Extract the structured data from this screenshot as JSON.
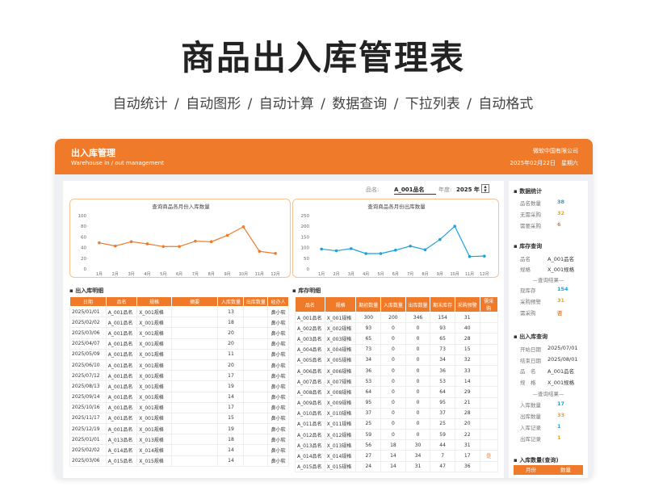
{
  "hero": {
    "title": "商品出入库管理表",
    "subtitle": "自动统计 / 自动图形 / 自动计算 / 数据查询 / 下拉列表 / 自动格式"
  },
  "header": {
    "title": "出入库管理",
    "subtitle": "Warehouse in / out management",
    "company": "微软中国有限公司",
    "date": "2025年02月22日",
    "weekday": "星期六"
  },
  "filter": {
    "name_label": "品名:",
    "name_value": "A_001品名",
    "year_label": "年度:",
    "year_value": "2025 年"
  },
  "charts": [
    {
      "title": "查询商品各月份入库数量",
      "yticks": [
        0,
        20,
        40,
        60,
        80,
        100
      ],
      "ylim": [
        0,
        100
      ]
    },
    {
      "title": "查询商品各月份出库数量",
      "yticks": [
        0,
        50,
        100,
        150,
        200,
        250
      ],
      "ylim": [
        0,
        250
      ]
    }
  ],
  "chart_data": [
    {
      "type": "line",
      "title": "查询商品各月份入库数量",
      "categories": [
        "1月",
        "2月",
        "3月",
        "4月",
        "5月",
        "6月",
        "7月",
        "8月",
        "9月",
        "10月",
        "11月",
        "12月"
      ],
      "values": [
        49,
        43,
        51,
        47,
        42,
        42,
        52,
        51,
        63,
        79,
        33,
        29
      ],
      "ylim": [
        0,
        100
      ],
      "color": "#ef7b2a"
    },
    {
      "type": "line",
      "title": "查询商品各月份出库数量",
      "categories": [
        "1月",
        "2月",
        "3月",
        "4月",
        "5月",
        "6月",
        "7月",
        "8月",
        "9月",
        "10月",
        "11月",
        "12月"
      ],
      "values": [
        93,
        85,
        95,
        72,
        72,
        88,
        107,
        90,
        138,
        200,
        58,
        60
      ],
      "ylim": [
        0,
        250
      ],
      "color": "#1aa3d9"
    }
  ],
  "sections": {
    "inout": "出入库明细",
    "stock": "库存明细"
  },
  "inout_table": {
    "headers": [
      "日期",
      "品名",
      "规格",
      "摘要",
      "入库数量",
      "出库数量",
      "经办人"
    ],
    "rows": [
      [
        "2025/01/01",
        "A_001品名",
        "X_001规格",
        "",
        "13",
        "",
        "鼻小软"
      ],
      [
        "2025/02/02",
        "A_001品名",
        "X_001规格",
        "",
        "18",
        "",
        "鼻小软"
      ],
      [
        "2025/03/06",
        "A_001品名",
        "X_001规格",
        "",
        "20",
        "",
        "鼻小软"
      ],
      [
        "2025/04/07",
        "A_001品名",
        "X_001规格",
        "",
        "20",
        "",
        "鼻小软"
      ],
      [
        "2025/05/09",
        "A_001品名",
        "X_001规格",
        "",
        "11",
        "",
        "鼻小软"
      ],
      [
        "2025/06/10",
        "A_001品名",
        "X_001规格",
        "",
        "20",
        "",
        "鼻小软"
      ],
      [
        "2025/07/12",
        "A_001品名",
        "X_001规格",
        "",
        "17",
        "",
        "鼻小软"
      ],
      [
        "2025/08/13",
        "A_001品名",
        "X_001规格",
        "",
        "19",
        "",
        "鼻小软"
      ],
      [
        "2025/09/14",
        "A_001品名",
        "X_001规格",
        "",
        "14",
        "",
        "鼻小软"
      ],
      [
        "2025/10/16",
        "A_001品名",
        "X_001规格",
        "",
        "17",
        "",
        "鼻小软"
      ],
      [
        "2025/11/17",
        "A_001品名",
        "X_001规格",
        "",
        "15",
        "",
        "鼻小软"
      ],
      [
        "2025/12/19",
        "A_001品名",
        "X_001规格",
        "",
        "19",
        "",
        "鼻小软"
      ],
      [
        "2025/01/01",
        "A_013品名",
        "X_013规格",
        "",
        "18",
        "",
        "鼻小软"
      ],
      [
        "2025/02/02",
        "A_014品名",
        "X_014规格",
        "",
        "14",
        "",
        "鼻小软"
      ],
      [
        "2025/03/06",
        "A_015品名",
        "X_015规格",
        "",
        "14",
        "",
        "鼻小软"
      ]
    ]
  },
  "stock_table": {
    "headers": [
      "品名",
      "规格",
      "期初数量",
      "入库数量",
      "出库数量",
      "期末库存",
      "采购预警",
      "需采购"
    ],
    "rows": [
      [
        "A_001品名",
        "X_001规格",
        "300",
        "200",
        "346",
        "154",
        "31",
        ""
      ],
      [
        "A_002品名",
        "X_002规格",
        "93",
        "0",
        "0",
        "93",
        "40",
        ""
      ],
      [
        "A_003品名",
        "X_003规格",
        "65",
        "0",
        "0",
        "65",
        "28",
        ""
      ],
      [
        "A_004品名",
        "X_004规格",
        "73",
        "0",
        "0",
        "73",
        "15",
        ""
      ],
      [
        "A_005品名",
        "X_005规格",
        "34",
        "0",
        "0",
        "34",
        "32",
        ""
      ],
      [
        "A_006品名",
        "X_006规格",
        "36",
        "0",
        "0",
        "36",
        "33",
        ""
      ],
      [
        "A_007品名",
        "X_007规格",
        "53",
        "0",
        "0",
        "53",
        "14",
        ""
      ],
      [
        "A_008品名",
        "X_008规格",
        "64",
        "0",
        "0",
        "64",
        "29",
        ""
      ],
      [
        "A_009品名",
        "X_009规格",
        "95",
        "0",
        "0",
        "95",
        "21",
        ""
      ],
      [
        "A_010品名",
        "X_010规格",
        "37",
        "0",
        "0",
        "37",
        "28",
        ""
      ],
      [
        "A_011品名",
        "X_011规格",
        "25",
        "0",
        "0",
        "25",
        "20",
        ""
      ],
      [
        "A_012品名",
        "X_012规格",
        "59",
        "0",
        "0",
        "59",
        "22",
        ""
      ],
      [
        "A_013品名",
        "X_013规格",
        "56",
        "18",
        "30",
        "44",
        "31",
        ""
      ],
      [
        "A_014品名",
        "X_014规格",
        "27",
        "14",
        "34",
        "7",
        "17",
        "是"
      ],
      [
        "A_015品名",
        "X_015规格",
        "24",
        "14",
        "31",
        "47",
        "36",
        ""
      ]
    ]
  },
  "side": {
    "stats_title": "数据统计",
    "stats": [
      {
        "label": "品名数量",
        "value": "38",
        "color": "#1aa3d9"
      },
      {
        "label": "无需采购",
        "value": "32",
        "color": "#f0a500"
      },
      {
        "label": "需要采购",
        "value": "6",
        "color": "#ef7b2a"
      }
    ],
    "stock_title": "库存查询",
    "stock_name_label": "品名",
    "stock_name": "A_001品名",
    "stock_spec_label": "规格",
    "stock_spec": "X_001规格",
    "stock_result": "—查询结果—",
    "stock_stats": [
      {
        "label": "现库存",
        "value": "154",
        "color": "#1aa3d9"
      },
      {
        "label": "采购预警",
        "value": "31",
        "color": "#f0a500"
      },
      {
        "label": "需采购",
        "value": "否",
        "color": "#ef7b2a"
      }
    ],
    "io_title": "出入库查询",
    "io_fields": [
      {
        "label": "开始日期",
        "value": "2025/07/01"
      },
      {
        "label": "结束日期",
        "value": "2025/08/01"
      },
      {
        "label": "品　名",
        "value": "A_001品名"
      },
      {
        "label": "规　格",
        "value": "X_001规格"
      }
    ],
    "io_result": "—查询结果—",
    "io_stats": [
      {
        "label": "入库数量",
        "value": "17",
        "color": "#1aa3d9"
      },
      {
        "label": "出库数量",
        "value": "33",
        "color": "#f0a500"
      },
      {
        "label": "入库记录",
        "value": "1",
        "color": "#1aa3d9"
      },
      {
        "label": "出库记录",
        "value": "1",
        "color": "#f0a500"
      }
    ],
    "in_title": "入库数量(查询)",
    "in_headers": [
      "月份",
      "数量"
    ]
  }
}
